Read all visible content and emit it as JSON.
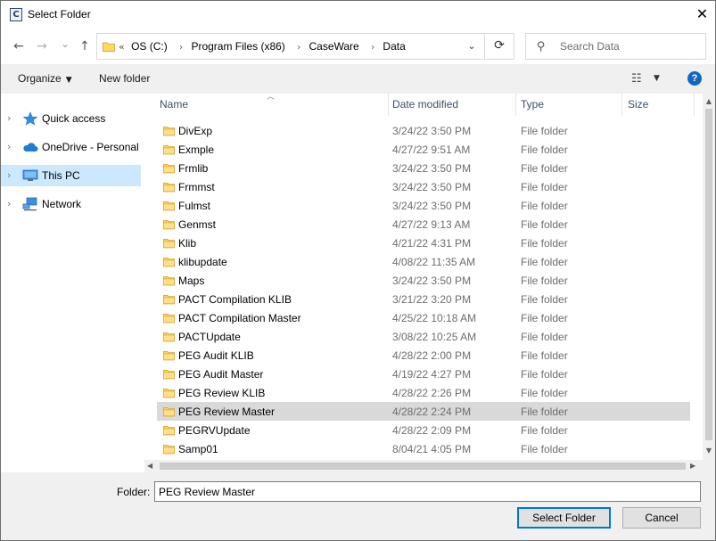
{
  "window": {
    "title": "Select Folder",
    "app_icon_letter": "C"
  },
  "nav": {
    "back": "←",
    "forward": "→",
    "recent": "⌄",
    "up": "↑",
    "breadcrumb_overflow": "«",
    "breadcrumb": [
      "OS (C:)",
      "Program Files (x86)",
      "CaseWare",
      "Data"
    ],
    "breadcrumb_sep": "›",
    "address_dropdown": "⌄",
    "refresh": "⟳"
  },
  "search": {
    "placeholder": "Search Data"
  },
  "toolbar": {
    "organize_label": "Organize",
    "new_folder_label": "New folder",
    "help": "?"
  },
  "sidebar": {
    "items": [
      {
        "label": "Quick access"
      },
      {
        "label": "OneDrive - Personal"
      },
      {
        "label": "This PC"
      },
      {
        "label": "Network"
      }
    ]
  },
  "columns": {
    "name": "Name",
    "date": "Date modified",
    "type": "Type",
    "size": "Size"
  },
  "files": [
    {
      "name": "DivExp",
      "date": "3/24/22 3:50 PM",
      "type": "File folder"
    },
    {
      "name": "Exmple",
      "date": "4/27/22 9:51 AM",
      "type": "File folder"
    },
    {
      "name": "Frmlib",
      "date": "3/24/22 3:50 PM",
      "type": "File folder"
    },
    {
      "name": "Frmmst",
      "date": "3/24/22 3:50 PM",
      "type": "File folder"
    },
    {
      "name": "Fulmst",
      "date": "3/24/22 3:50 PM",
      "type": "File folder"
    },
    {
      "name": "Genmst",
      "date": "4/27/22 9:13 AM",
      "type": "File folder"
    },
    {
      "name": "Klib",
      "date": "4/21/22 4:31 PM",
      "type": "File folder"
    },
    {
      "name": "klibupdate",
      "date": "4/08/22 11:35 AM",
      "type": "File folder"
    },
    {
      "name": "Maps",
      "date": "3/24/22 3:50 PM",
      "type": "File folder"
    },
    {
      "name": "PACT Compilation KLIB",
      "date": "3/21/22 3:20 PM",
      "type": "File folder"
    },
    {
      "name": "PACT Compilation Master",
      "date": "4/25/22 10:18 AM",
      "type": "File folder"
    },
    {
      "name": "PACTUpdate",
      "date": "3/08/22 10:25 AM",
      "type": "File folder"
    },
    {
      "name": "PEG Audit KLIB",
      "date": "4/28/22 2:00 PM",
      "type": "File folder"
    },
    {
      "name": "PEG Audit Master",
      "date": "4/19/22 4:27 PM",
      "type": "File folder"
    },
    {
      "name": "PEG Review KLIB",
      "date": "4/28/22 2:26 PM",
      "type": "File folder"
    },
    {
      "name": "PEG Review Master",
      "date": "4/28/22 2:24 PM",
      "type": "File folder"
    },
    {
      "name": "PEGRVUpdate",
      "date": "4/28/22 2:09 PM",
      "type": "File folder"
    },
    {
      "name": "Samp01",
      "date": "8/04/21 4:05 PM",
      "type": "File folder"
    }
  ],
  "selected_file": "PEG Review Master",
  "footer": {
    "folder_label": "Folder:",
    "folder_value": "PEG Review Master",
    "select_label": "Select Folder",
    "cancel_label": "Cancel"
  },
  "colors": {
    "accent": "#0078d7",
    "selection": "#cce8ff",
    "row_selected": "#d9d9d9",
    "folder": "#ffd767",
    "help": "#1167c4"
  }
}
